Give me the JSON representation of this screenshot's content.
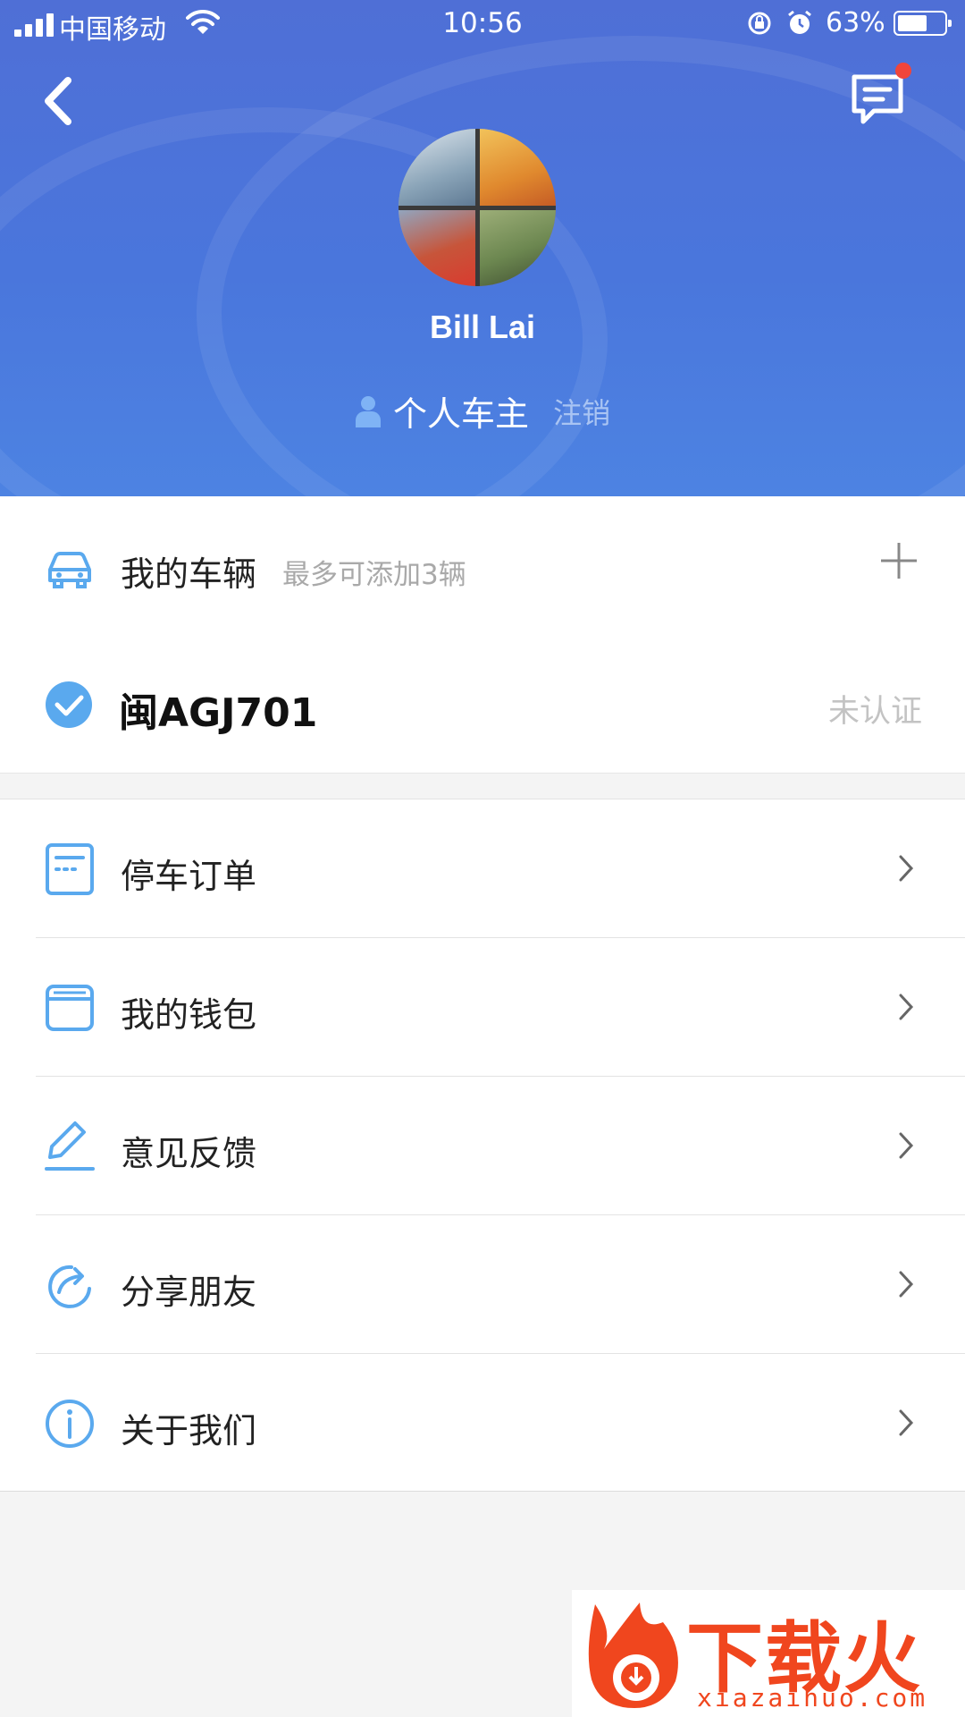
{
  "status_bar": {
    "carrier": "中国移动",
    "time": "10:56",
    "battery_percent": "63%",
    "battery_level": 0.63
  },
  "header": {
    "user_name": "Bill Lai",
    "role": "个人车主",
    "logout": "注销",
    "has_unread_message": true
  },
  "vehicles": {
    "title": "我的车辆",
    "hint": "最多可添加3辆",
    "items": [
      {
        "plate": "闽AGJ701",
        "status": "未认证"
      }
    ]
  },
  "menu": {
    "items": [
      {
        "label": "停车订单",
        "icon": "receipt-icon"
      },
      {
        "label": "我的钱包",
        "icon": "wallet-icon"
      },
      {
        "label": "意见反馈",
        "icon": "feedback-pencil-icon"
      },
      {
        "label": "分享朋友",
        "icon": "share-icon"
      },
      {
        "label": "关于我们",
        "icon": "info-icon"
      }
    ]
  },
  "watermark": {
    "logo": "下载火",
    "url": "xiazaihuo.com"
  },
  "colors": {
    "header_blue": "#4a76dc",
    "accent_blue": "#5aa9ee",
    "notification_red": "#f0453a",
    "watermark_orange": "#f0461e"
  }
}
